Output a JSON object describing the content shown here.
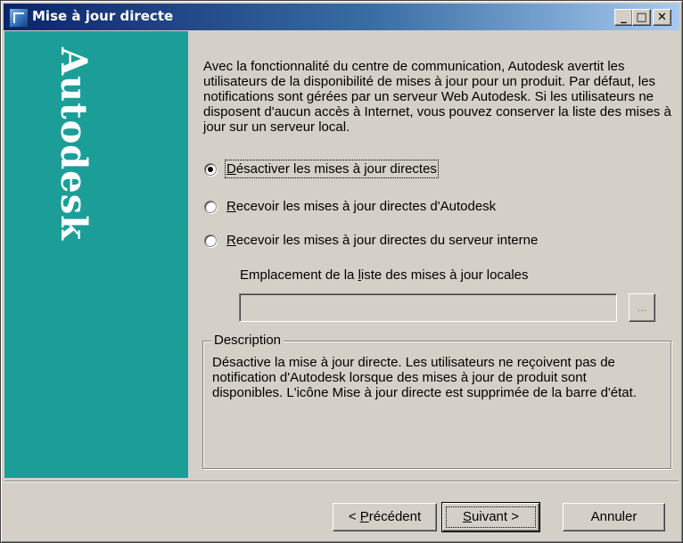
{
  "window": {
    "title": "Mise à jour directe",
    "controls": {
      "minimize": "_",
      "maximize": "□",
      "close": "✕"
    }
  },
  "brand": {
    "logo_text": "Autodesk"
  },
  "intro": "Avec la fonctionnalité du centre de communication, Autodesk avertit les utilisateurs de la disponibilité de mises à jour pour un produit. Par défaut, les notifications sont gérées par un serveur Web Autodesk. Si les utilisateurs ne disposent d'aucun accès à Internet, vous pouvez conserver la liste des mises à jour sur un serveur local.",
  "options": [
    {
      "pre": "",
      "mnemonic": "D",
      "rest": "ésactiver les mises à jour directes",
      "checked": true
    },
    {
      "pre": "",
      "mnemonic": "R",
      "rest": "ecevoir les mises à jour directes d'Autodesk",
      "checked": false
    },
    {
      "pre": "",
      "mnemonic": "R",
      "rest": "ecevoir les mises à jour directes du serveur interne",
      "checked": false
    }
  ],
  "location": {
    "label_pre": "Emplacement de la ",
    "label_mnemonic": "l",
    "label_rest": "iste des mises à jour locales",
    "value": "",
    "browse_label": "..."
  },
  "description": {
    "legend": "Description",
    "text": "Désactive la mise à jour directe. Les utilisateurs ne reçoivent pas de notification d'Autodesk lorsque des mises à jour de produit sont disponibles. L'icône Mise à jour directe est supprimée de la barre d'état."
  },
  "buttons": {
    "prev_pre": "< ",
    "prev_mnemonic": "P",
    "prev_rest": "récédent",
    "next_mnemonic": "S",
    "next_rest": "uivant >",
    "cancel": "Annuler"
  }
}
